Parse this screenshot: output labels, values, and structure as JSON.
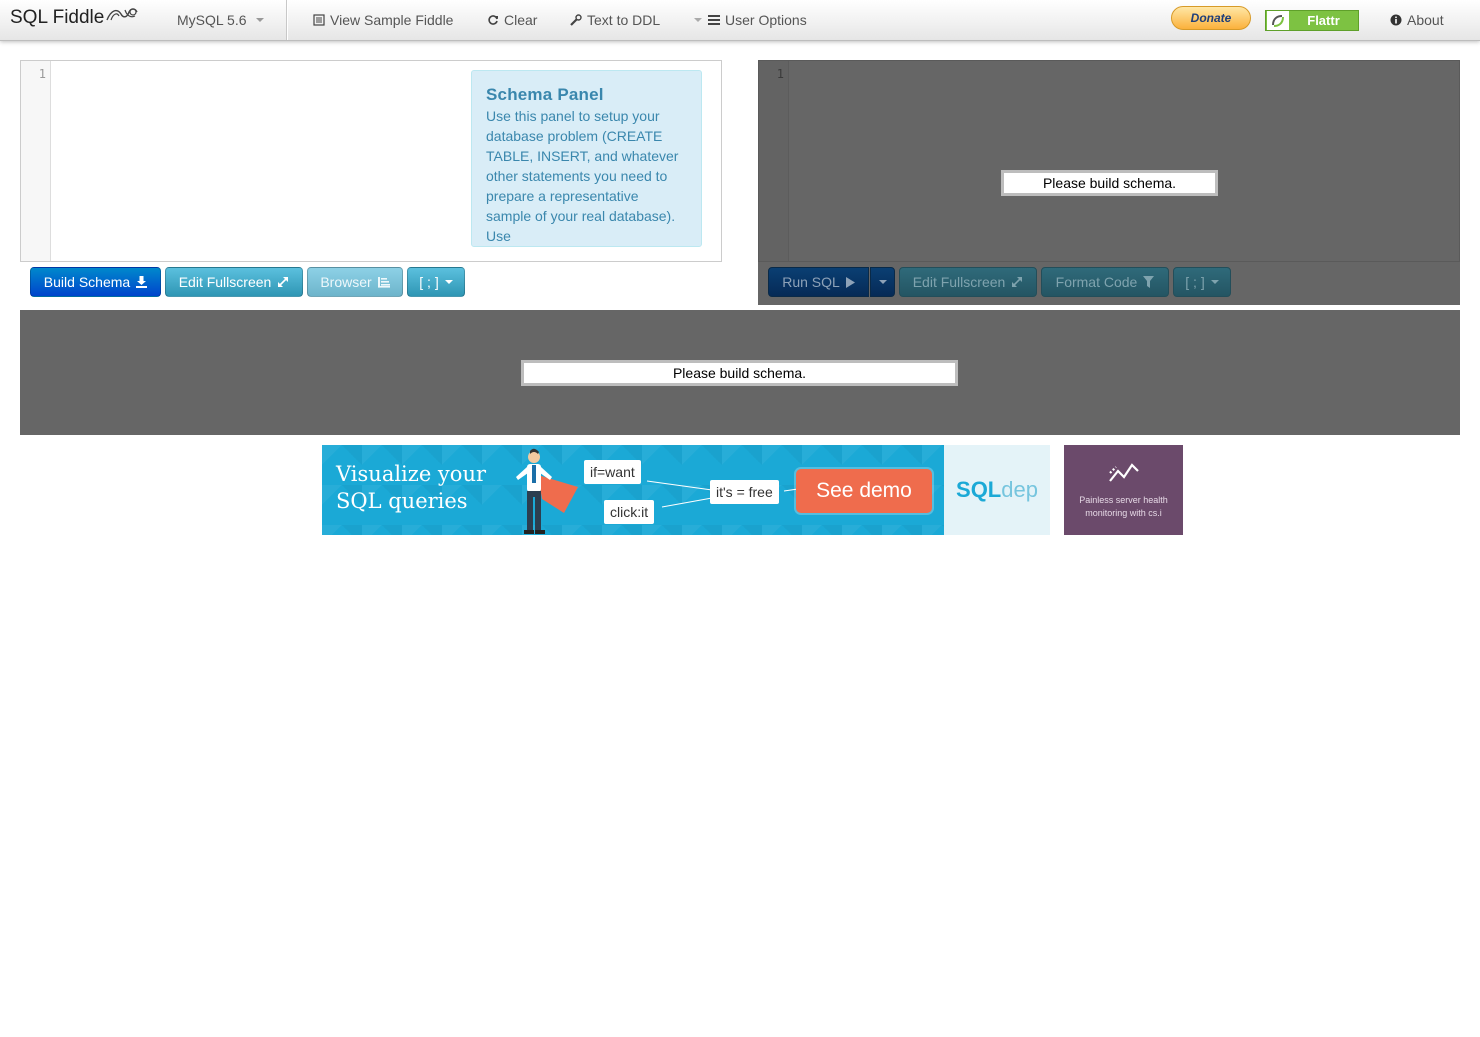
{
  "navbar": {
    "brand": "SQL Fiddle",
    "db_selector": "MySQL 5.6",
    "view_sample": "View Sample Fiddle",
    "clear": "Clear",
    "text_to_ddl": "Text to DDL",
    "user_options": "User Options",
    "donate": "Donate",
    "flattr": "Flattr",
    "about": "About"
  },
  "schema": {
    "line_number": "1",
    "help_title": "Schema Panel",
    "help_text": "Use this panel to setup your database problem (CREATE TABLE, INSERT, and whatever other statements you need to prepare a representative sample of your real database). Use",
    "buttons": {
      "build": "Build Schema",
      "fullscreen": "Edit Fullscreen",
      "browser": "Browser",
      "terminator": "[ ; ]"
    }
  },
  "query": {
    "line_number": "1",
    "message": "Please build schema.",
    "buttons": {
      "run": "Run SQL",
      "fullscreen": "Edit Fullscreen",
      "format": "Format Code",
      "terminator": "[ ; ]"
    }
  },
  "results": {
    "message": "Please build schema."
  },
  "ad": {
    "headline_1": "Visualize your",
    "headline_2": "SQL queries",
    "tag_want": "if=want",
    "tag_click": "click:it",
    "tag_free": "it's = free",
    "cta": "See demo",
    "logo_a": "SQL",
    "logo_b": "dep",
    "side_text": "Painless server health monitoring with cs.i"
  }
}
